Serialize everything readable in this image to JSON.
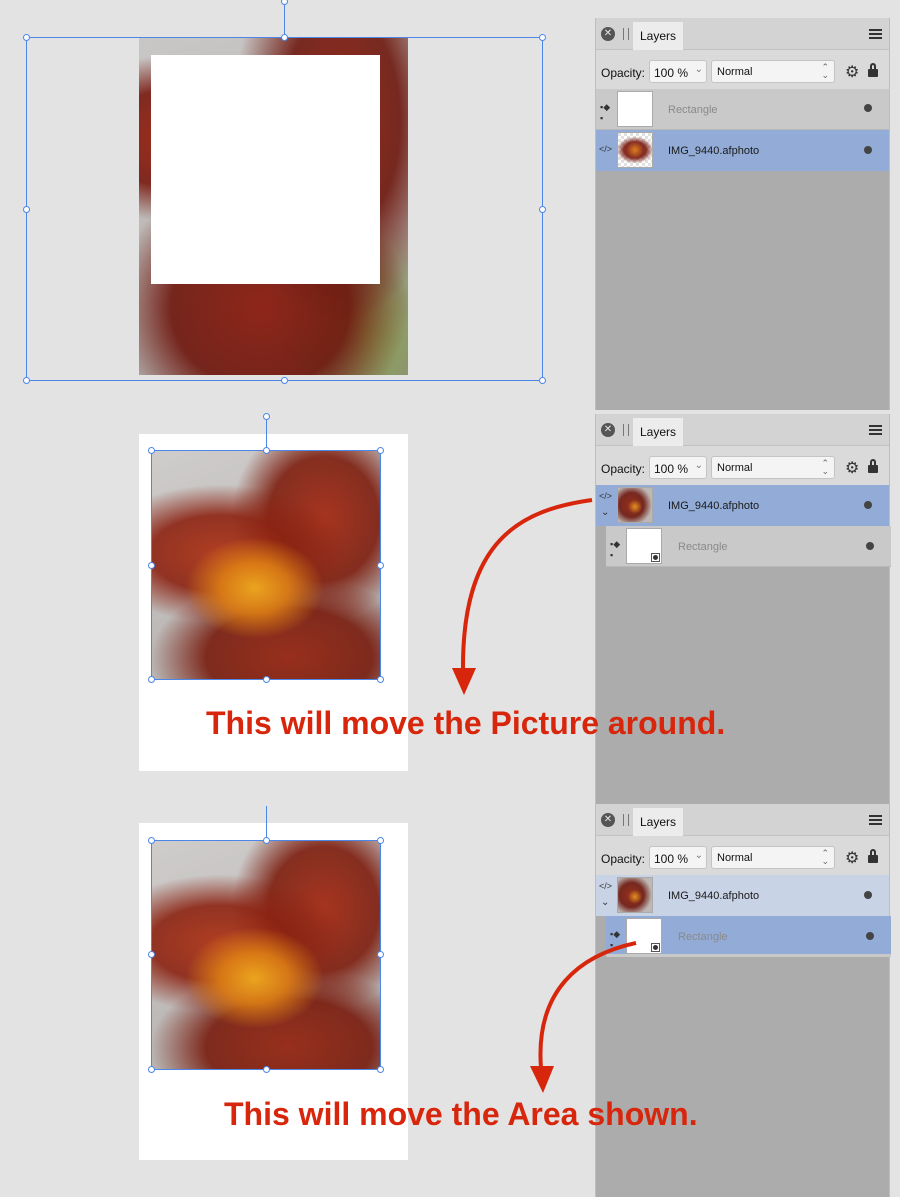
{
  "panel": {
    "tab_label": "Layers",
    "opacity_label": "Opacity:",
    "opacity_value": "100 %",
    "blend_mode": "Normal"
  },
  "panels": [
    {
      "layers": [
        {
          "name": "Rectangle",
          "type": "shape",
          "state": "faded"
        },
        {
          "name": "IMG_9440.afphoto",
          "type": "embedded-document",
          "state": "selected"
        }
      ]
    },
    {
      "layers": [
        {
          "name": "IMG_9440.afphoto",
          "type": "embedded-document",
          "state": "selected",
          "expanded": true
        },
        {
          "name": "Rectangle",
          "type": "shape",
          "state": "faded",
          "child": true
        }
      ]
    },
    {
      "layers": [
        {
          "name": "IMG_9440.afphoto",
          "type": "embedded-document",
          "state": "parent-highlight",
          "expanded": true
        },
        {
          "name": "Rectangle",
          "type": "shape",
          "state": "selected",
          "child": true
        }
      ]
    }
  ],
  "annotations": {
    "picture": "This will move the Picture around.",
    "area": "This will move the Area shown."
  },
  "colors": {
    "annotation": "#d7260c",
    "selection": "#4c86e8",
    "selected_row": "#92acd7",
    "panel_bg": "#acacac"
  },
  "icons": {
    "close": "close-icon",
    "menu": "hamburger-menu-icon",
    "settings": "gear-icon",
    "lock": "lock-icon",
    "embedded_document": "embedded-document-icon",
    "shape": "shape-icon",
    "visibility": "visibility-dot-icon",
    "expand": "chevron-down-icon"
  }
}
